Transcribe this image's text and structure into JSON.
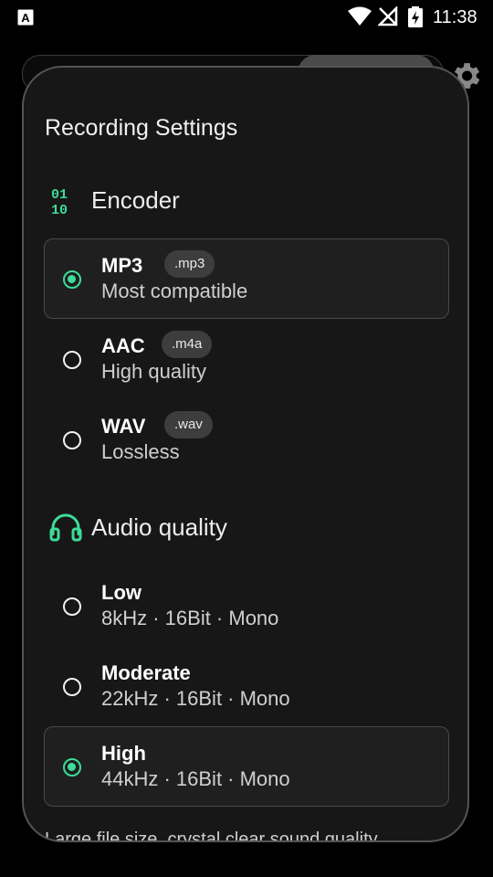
{
  "status_bar": {
    "time": "11:38"
  },
  "sheet": {
    "title": "Recording Settings",
    "encoder": {
      "label": "Encoder",
      "options": [
        {
          "name": "MP3",
          "ext": ".mp3",
          "desc": "Most compatible",
          "selected": true
        },
        {
          "name": "AAC",
          "ext": ".m4a",
          "desc": "High quality",
          "selected": false
        },
        {
          "name": "WAV",
          "ext": ".wav",
          "desc": "Lossless",
          "selected": false
        }
      ]
    },
    "audio_quality": {
      "label": "Audio quality",
      "options": [
        {
          "name": "Low",
          "desc": "8kHz · 16Bit · Mono",
          "selected": false
        },
        {
          "name": "Moderate",
          "desc": "22kHz · 16Bit · Mono",
          "selected": false
        },
        {
          "name": "High",
          "desc": "44kHz · 16Bit · Mono",
          "selected": true
        }
      ]
    },
    "footer_text": "Large file size, crystal clear sound quality"
  },
  "colors": {
    "accent": "#3ddc97",
    "sheet_bg": "#171717",
    "page_bg": "#000000"
  },
  "icons": {
    "encoder": "binary-icon",
    "audio_quality": "headphones-icon",
    "settings": "gear-icon"
  }
}
